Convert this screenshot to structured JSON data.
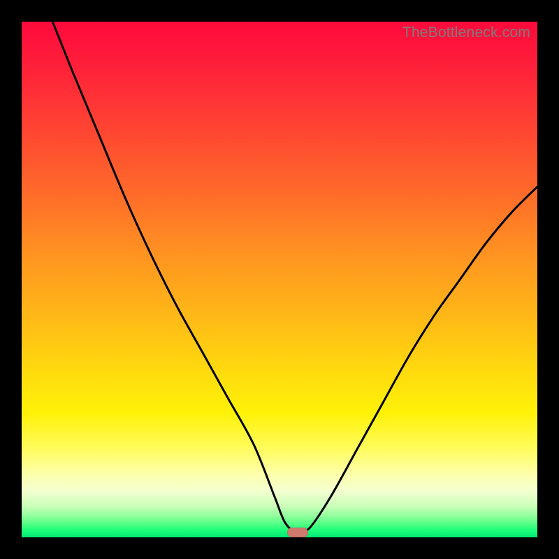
{
  "watermark": "TheBottleneck.com",
  "colors": {
    "curve_stroke": "#000000",
    "marker_fill": "#cf7a6d"
  },
  "chart_data": {
    "type": "line",
    "title": "",
    "xlabel": "",
    "ylabel": "",
    "xlim": [
      0,
      100
    ],
    "ylim": [
      0,
      100
    ],
    "grid": false,
    "legend": false,
    "series": [
      {
        "name": "bottleneck-curve",
        "x": [
          6,
          10,
          15,
          20,
          25,
          30,
          35,
          40,
          45,
          49,
          51,
          53,
          54,
          56,
          60,
          65,
          70,
          75,
          80,
          85,
          90,
          95,
          100
        ],
        "y": [
          100,
          90,
          78,
          66,
          55,
          45,
          36,
          27,
          18,
          8,
          3,
          1,
          1,
          2,
          8,
          17,
          26,
          35,
          43,
          50,
          57,
          63,
          68
        ]
      }
    ],
    "annotations": [
      {
        "name": "optimal-marker",
        "x": 53.5,
        "y": 1
      }
    ]
  }
}
